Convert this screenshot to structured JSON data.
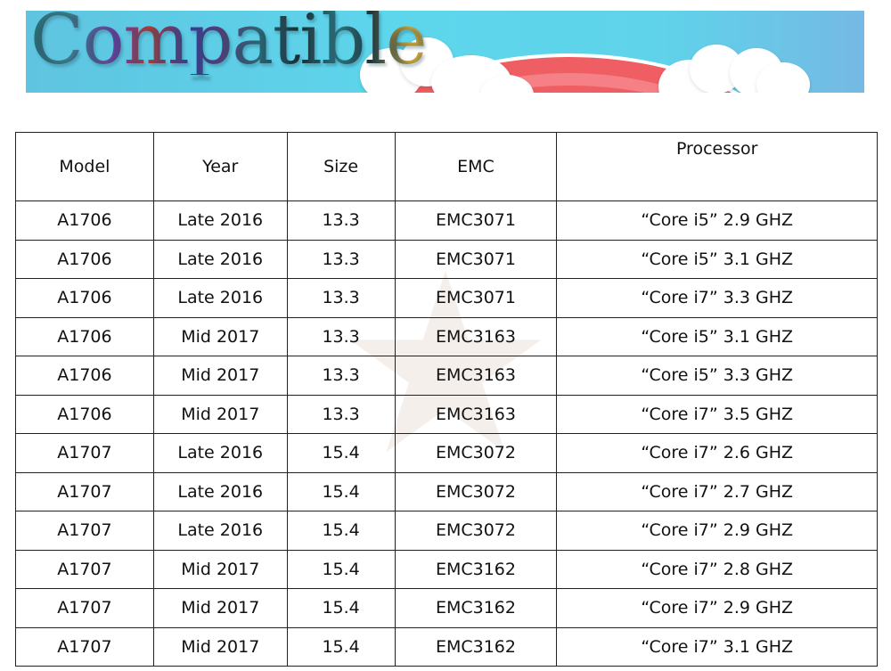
{
  "banner": {
    "title": "Compatible",
    "colors": {
      "sky": "#5dd6ec",
      "arc": "#ee5e62",
      "cloud": "#ffffff"
    }
  },
  "table": {
    "headers": [
      "Model",
      "Year",
      "Size",
      "EMC",
      "Processor"
    ],
    "rows": [
      [
        "A1706",
        "Late 2016",
        "13.3",
        "EMC3071",
        "“Core i5” 2.9 GHZ"
      ],
      [
        "A1706",
        "Late 2016",
        "13.3",
        "EMC3071",
        "“Core i5” 3.1 GHZ"
      ],
      [
        "A1706",
        "Late 2016",
        "13.3",
        "EMC3071",
        "“Core i7” 3.3 GHZ"
      ],
      [
        "A1706",
        "Mid 2017",
        "13.3",
        "EMC3163",
        "“Core i5” 3.1 GHZ"
      ],
      [
        "A1706",
        "Mid 2017",
        "13.3",
        "EMC3163",
        "“Core i5” 3.3 GHZ"
      ],
      [
        "A1706",
        "Mid 2017",
        "13.3",
        "EMC3163",
        "“Core i7” 3.5 GHZ"
      ],
      [
        "A1707",
        "Late 2016",
        "15.4",
        "EMC3072",
        "“Core i7” 2.6 GHZ"
      ],
      [
        "A1707",
        "Late 2016",
        "15.4",
        "EMC3072",
        "“Core i7” 2.7 GHZ"
      ],
      [
        "A1707",
        "Late 2016",
        "15.4",
        "EMC3072",
        "“Core i7” 2.9 GHZ"
      ],
      [
        "A1707",
        "Mid 2017",
        "15.4",
        "EMC3162",
        "“Core i7” 2.8 GHZ"
      ],
      [
        "A1707",
        "Mid 2017",
        "15.4",
        "EMC3162",
        "“Core i7” 2.9 GHZ"
      ],
      [
        "A1707",
        "Mid 2017",
        "15.4",
        "EMC3162",
        "“Core i7” 3.1 GHZ"
      ]
    ]
  }
}
